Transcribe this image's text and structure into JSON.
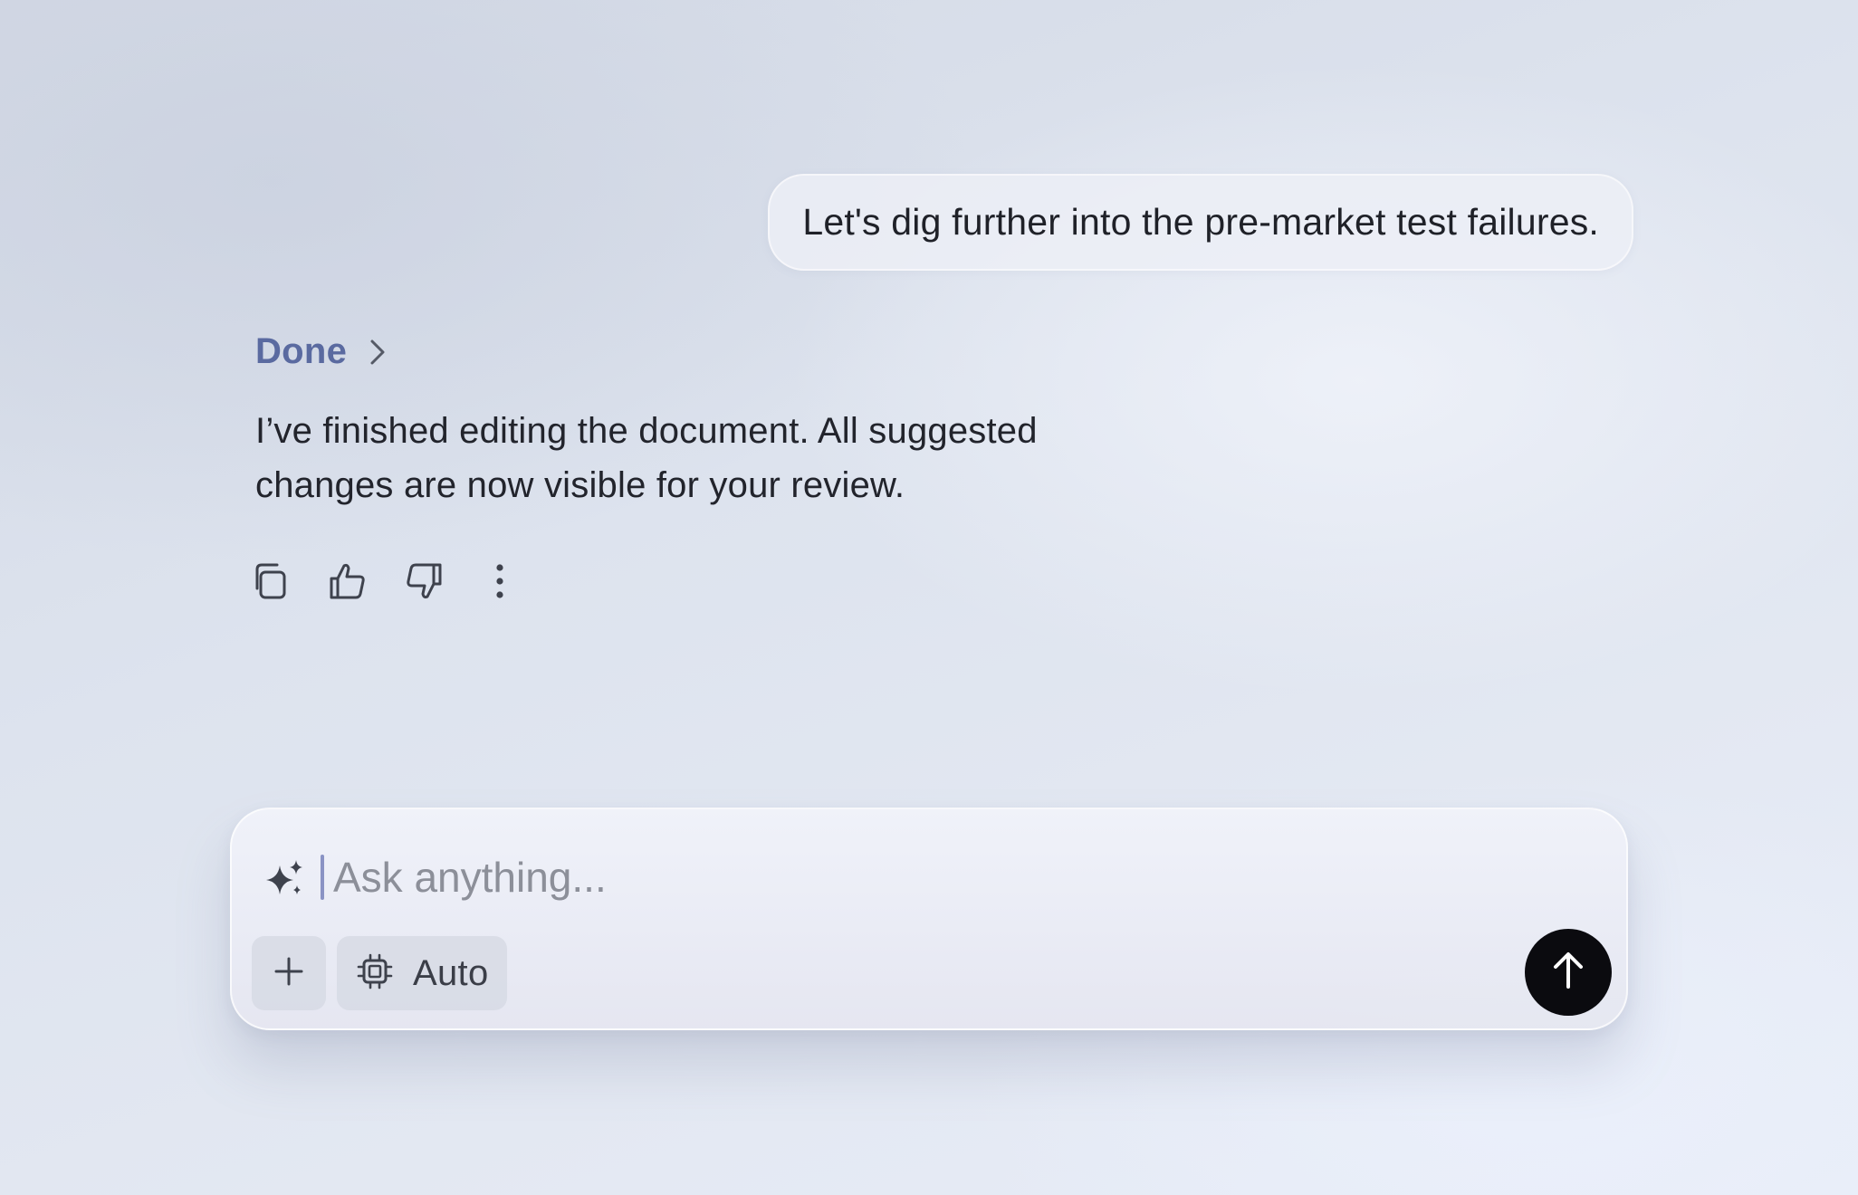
{
  "conversation": {
    "user_message": "Let's dig further into the pre-market test failures.",
    "assistant_status": "Done",
    "assistant_message": "I’ve finished editing the document. All suggested changes are now visible for your review.",
    "actions": [
      {
        "icon": "copy-icon"
      },
      {
        "icon": "thumbs-up-icon"
      },
      {
        "icon": "thumbs-down-icon"
      },
      {
        "icon": "more-vertical-icon"
      }
    ]
  },
  "composer": {
    "placeholder": "Ask anything...",
    "value": "",
    "model_label": "Auto",
    "icons": {
      "leading": "sparkle-icon",
      "add": "plus-icon",
      "model": "chip-icon",
      "send": "arrow-up-icon"
    }
  },
  "colors": {
    "status_accent": "#5a6aa0",
    "send_button": "#0b0b0f",
    "caret": "#8a93c4"
  }
}
